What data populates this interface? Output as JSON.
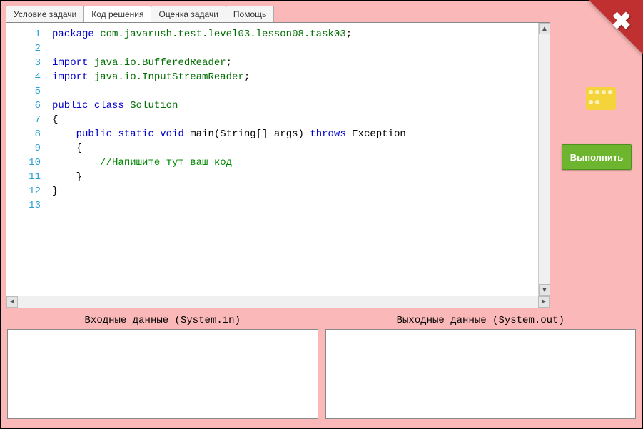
{
  "tabs": {
    "task": "Условие задачи",
    "code": "Код решения",
    "grade": "Оценка задачи",
    "help": "Помощь"
  },
  "code_lines": [
    {
      "n": 1,
      "tokens": [
        [
          "kw",
          "package"
        ],
        [
          "",
          " "
        ],
        [
          "pkg",
          "com.javarush.test.level03.lesson08.task03"
        ],
        [
          "",
          ";"
        ]
      ]
    },
    {
      "n": 2,
      "tokens": []
    },
    {
      "n": 3,
      "tokens": [
        [
          "kw",
          "import"
        ],
        [
          "",
          " "
        ],
        [
          "pkg",
          "java.io.BufferedReader"
        ],
        [
          "",
          ";"
        ]
      ]
    },
    {
      "n": 4,
      "tokens": [
        [
          "kw",
          "import"
        ],
        [
          "",
          " "
        ],
        [
          "pkg",
          "java.io.InputStreamReader"
        ],
        [
          "",
          ";"
        ]
      ]
    },
    {
      "n": 5,
      "tokens": []
    },
    {
      "n": 6,
      "tokens": [
        [
          "kw",
          "public"
        ],
        [
          "",
          " "
        ],
        [
          "kw",
          "class"
        ],
        [
          "",
          " "
        ],
        [
          "cls",
          "Solution"
        ]
      ]
    },
    {
      "n": 7,
      "tokens": [
        [
          "",
          "{"
        ]
      ]
    },
    {
      "n": 8,
      "tokens": [
        [
          "",
          "    "
        ],
        [
          "kw",
          "public"
        ],
        [
          "",
          " "
        ],
        [
          "kw",
          "static"
        ],
        [
          "",
          " "
        ],
        [
          "kw",
          "void"
        ],
        [
          "",
          " main(String[] args) "
        ],
        [
          "kw",
          "throws"
        ],
        [
          "",
          " Exception"
        ]
      ]
    },
    {
      "n": 9,
      "tokens": [
        [
          "",
          "    {"
        ]
      ]
    },
    {
      "n": 10,
      "tokens": [
        [
          "",
          "        "
        ],
        [
          "cmt",
          "//Напишите тут ваш код"
        ]
      ]
    },
    {
      "n": 11,
      "tokens": [
        [
          "",
          "    }"
        ]
      ]
    },
    {
      "n": 12,
      "tokens": [
        [
          "",
          "}"
        ]
      ]
    },
    {
      "n": 13,
      "tokens": []
    }
  ],
  "sidebar": {
    "run_label": "Выполнить"
  },
  "io": {
    "input_label": "Входные данные (System.in)",
    "output_label": "Выходные данные (System.out)"
  },
  "colors": {
    "bg": "#fbb8b8",
    "run_btn": "#6eb52f",
    "ribbon": "#c03030",
    "icon": "#f5d33a"
  }
}
